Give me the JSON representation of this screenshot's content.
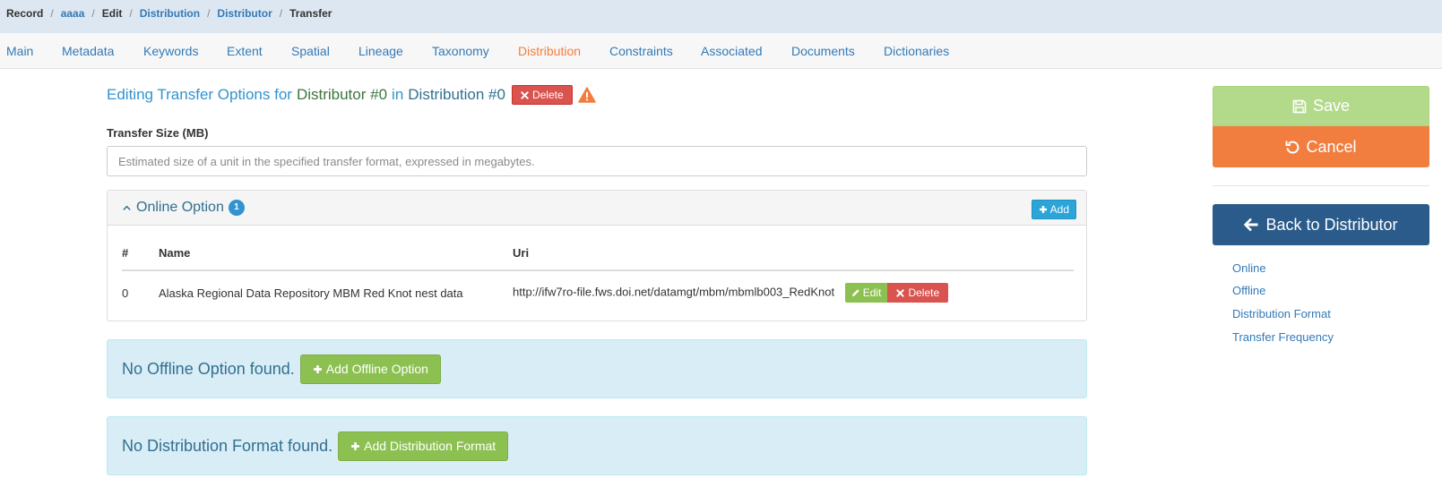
{
  "breadcrumb": {
    "items": [
      {
        "label": "Record"
      },
      {
        "label": "aaaa"
      },
      {
        "label": "Edit"
      },
      {
        "label": "Distribution"
      },
      {
        "label": "Distributor"
      },
      {
        "label": "Transfer"
      }
    ],
    "separator": "/"
  },
  "tabs": {
    "active": "Distribution",
    "items": [
      {
        "label": "Main"
      },
      {
        "label": "Metadata"
      },
      {
        "label": "Keywords"
      },
      {
        "label": "Extent"
      },
      {
        "label": "Spatial"
      },
      {
        "label": "Lineage"
      },
      {
        "label": "Taxonomy"
      },
      {
        "label": "Distribution"
      },
      {
        "label": "Constraints"
      },
      {
        "label": "Associated"
      },
      {
        "label": "Documents"
      },
      {
        "label": "Dictionaries"
      }
    ]
  },
  "heading": {
    "prefix": "Editing Transfer Options for",
    "distributor": "Distributor #0",
    "in": "in",
    "distribution": "Distribution #0",
    "delete_label": "Delete",
    "warning_icon": "warning-icon"
  },
  "transfer_size": {
    "label": "Transfer Size (MB)",
    "value": "",
    "placeholder": "Estimated size of a unit in the specified transfer format, expressed in megabytes."
  },
  "online_panel": {
    "title": "Online Option",
    "count": "1",
    "add_label": "Add",
    "columns": {
      "index": "#",
      "name": "Name",
      "uri": "Uri"
    },
    "rows": [
      {
        "index": "0",
        "name": "Alaska Regional Data Repository MBM Red Knot nest data",
        "uri": "http://ifw7ro-file.fws.doi.net/datamgt/mbm/mbmlb003_RedKnot",
        "edit_label": "Edit",
        "delete_label": "Delete"
      }
    ]
  },
  "offline_alert": {
    "text": "No Offline Option found.",
    "button_label": "Add Offline Option"
  },
  "format_alert": {
    "text": "No Distribution Format found.",
    "button_label": "Add Distribution Format"
  },
  "sidebar": {
    "save_label": "Save",
    "cancel_label": "Cancel",
    "back_label": "Back to Distributor",
    "links": [
      {
        "label": "Online"
      },
      {
        "label": "Offline"
      },
      {
        "label": "Distribution Format"
      },
      {
        "label": "Transfer Frequency"
      }
    ]
  },
  "colors": {
    "accent_blue": "#3193d0",
    "active_tab": "#f17e3f",
    "danger": "#d9534f",
    "success": "#8cc152",
    "save": "#b3da8b",
    "cancel": "#f17e3f",
    "back": "#2b5b8a",
    "info_bg": "#d9edf7"
  }
}
